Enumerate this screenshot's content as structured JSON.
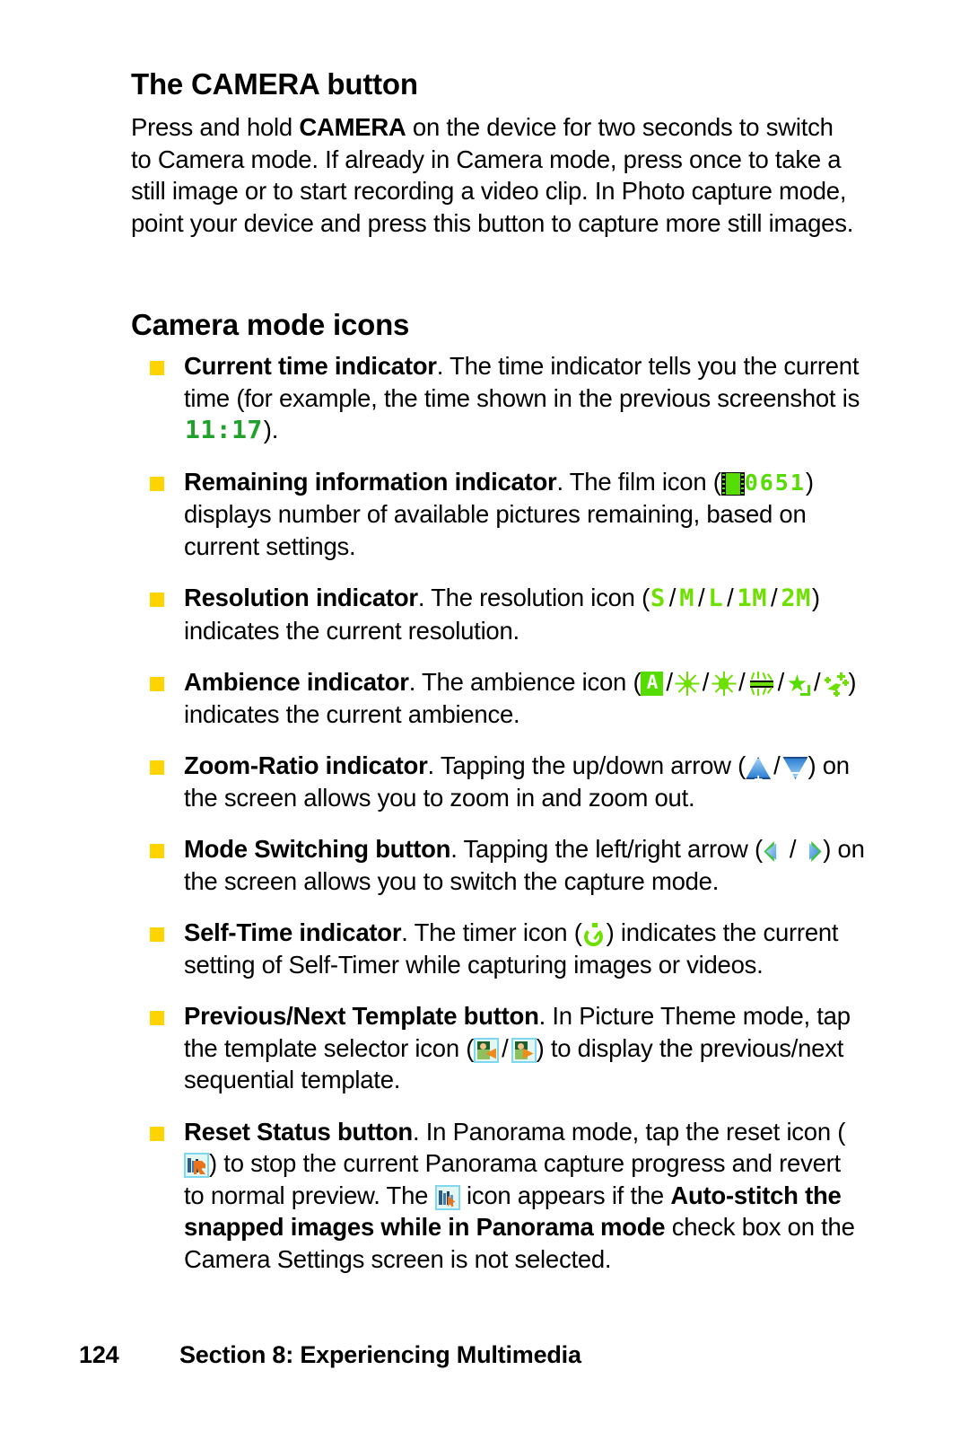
{
  "page": {
    "folio": "124",
    "footer_title": "Section 8: Experiencing Multimedia"
  },
  "sections": [
    {
      "heading": "The CAMERA button",
      "paragraph_parts": [
        {
          "text": "Press and hold ",
          "bold": false
        },
        {
          "text": "CAMERA",
          "bold": true
        },
        {
          "text": " on the device for two seconds to switch to Camera mode. If already in Camera mode, press once to take a still image or to start recording a video clip. In Photo capture mode, point your device and press this button to capture more still images.",
          "bold": false
        }
      ]
    },
    {
      "heading": "Camera mode icons"
    }
  ],
  "bullets": [
    {
      "term": "Current time indicator",
      "text_a": ". The time indicator tells you the current time (for example, the time shown in the previous screenshot is ",
      "icon_value": "11:17",
      "text_b": ")."
    },
    {
      "term": "Remaining information indicator",
      "text_a": ". The film icon (",
      "icon_value": "0651",
      "text_b": ") displays number of available pictures remaining, based on current settings.",
      "text_b_visible": ") displays number of available pictures remaining, based on current settings."
    },
    {
      "term": "Resolution indicator",
      "text_a": ". The resolution icon (",
      "options": [
        "S",
        "M",
        "L",
        "1M",
        "2M"
      ],
      "text_b": ") indicates the current resolution."
    },
    {
      "term": "Ambience indicator",
      "text_a": ". The ambience icon (",
      "icons": [
        "auto-icon",
        "daylight-icon",
        "incandescent-icon",
        "fluorescent-icon",
        "night-icon",
        "sparkle-icon"
      ],
      "text_b": ") indicates the current ambience."
    },
    {
      "term": "Zoom-Ratio indicator",
      "text_a": ". Tapping the up/down arrow (",
      "icons": [
        "zoom-in-arrow-icon",
        "zoom-out-arrow-icon"
      ],
      "text_b": ") on the screen allows you to zoom in and zoom out."
    },
    {
      "term": "Mode Switching button",
      "text_a": ". Tapping the left/right arrow (",
      "icons": [
        "mode-left-arrow-icon",
        "mode-right-arrow-icon"
      ],
      "text_b": ") on the screen allows you to switch the capture mode."
    },
    {
      "term": "Self-Time indicator",
      "text_a": ". The timer icon (",
      "icons": [
        "self-timer-icon"
      ],
      "text_b": ") indicates the current setting of Self-Timer while capturing images or videos."
    },
    {
      "term": "Previous/Next Template button",
      "text_a": ". In Picture Theme mode, tap the template selector icon (",
      "icons": [
        "previous-template-icon",
        "next-template-icon"
      ],
      "text_b": ") to display the previous/next sequential template."
    },
    {
      "term": "Reset Status button",
      "text_a": ". In Panorama mode, tap the reset icon (",
      "text_b": ") to stop the current Panorama capture progress and revert to normal preview. The ",
      "text_c": " icon appears if the ",
      "bold_phrase": "Auto-stitch the snapped images while in Panorama mode",
      "text_d": " check box on the Camera Settings screen is not selected."
    }
  ],
  "colors": {
    "bullet_marker": "#FFD400",
    "lcd_time_green": "#1FA12A",
    "lcd_count_green": "#55DD00",
    "resolution_green": "#6EE000",
    "arrow_blue": "#2E7FD4",
    "thumb_border": "#7FD8EE"
  }
}
